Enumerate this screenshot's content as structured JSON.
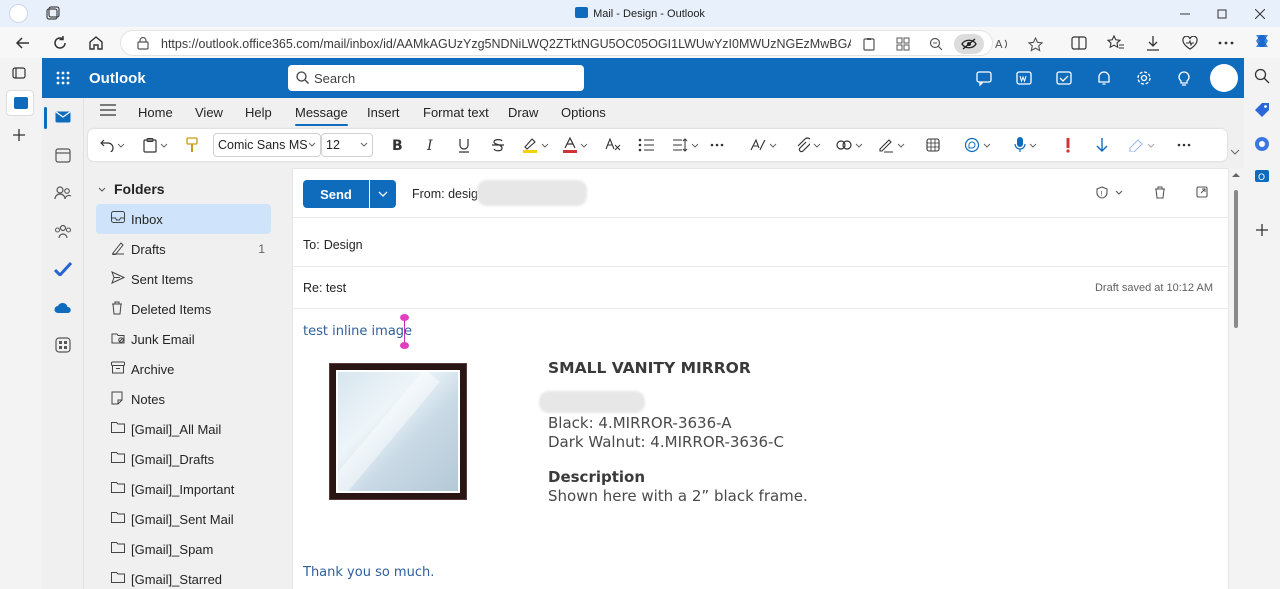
{
  "browser": {
    "window_title": "Mail - Design - Outlook",
    "url": "https://outlook.office365.com/mail/inbox/id/AAMkAGUzYzg5NDNiLWQ2ZTktNGU5OC05OGI1LWUwYzI0MWUzNGEzMwBGAAAAAA..."
  },
  "outlook": {
    "app_name": "Outlook",
    "search_placeholder": "Search",
    "ribbon_tabs": [
      "Home",
      "View",
      "Help",
      "Message",
      "Insert",
      "Format text",
      "Draw",
      "Options"
    ],
    "active_tab": "Message",
    "font_name": "Comic Sans MS",
    "font_size": "12"
  },
  "folders": {
    "header": "Folders",
    "items": [
      {
        "label": "Inbox",
        "count": "",
        "icon": "inbox-icon"
      },
      {
        "label": "Drafts",
        "count": "1",
        "icon": "drafts-icon"
      },
      {
        "label": "Sent Items",
        "count": "",
        "icon": "send-icon"
      },
      {
        "label": "Deleted Items",
        "count": "",
        "icon": "trash-icon"
      },
      {
        "label": "Junk Email",
        "count": "",
        "icon": "junk-icon"
      },
      {
        "label": "Archive",
        "count": "",
        "icon": "archive-icon"
      },
      {
        "label": "Notes",
        "count": "",
        "icon": "note-icon"
      },
      {
        "label": "[Gmail]_All Mail",
        "count": "",
        "icon": "folder-icon"
      },
      {
        "label": "[Gmail]_Drafts",
        "count": "",
        "icon": "folder-icon"
      },
      {
        "label": "[Gmail]_Important",
        "count": "",
        "icon": "folder-icon"
      },
      {
        "label": "[Gmail]_Sent Mail",
        "count": "",
        "icon": "folder-icon"
      },
      {
        "label": "[Gmail]_Spam",
        "count": "",
        "icon": "folder-icon"
      },
      {
        "label": "[Gmail]_Starred",
        "count": "",
        "icon": "folder-icon"
      }
    ]
  },
  "compose": {
    "send_label": "Send",
    "from_label": "From: design",
    "to_label": "To:",
    "to_value": "Design",
    "subject": "Re: test",
    "draft_status": "Draft saved at 10:12 AM",
    "body_first_line": "test inline image",
    "closing_line": "Thank you so much."
  },
  "product": {
    "title": "SMALL VANITY MIRROR",
    "line1": "Black: 4.MIRROR-3636-A",
    "line2": "Dark Walnut: 4.MIRROR-3636-C",
    "desc_heading": "Description",
    "desc_text": "Shown here with a 2” black frame."
  },
  "colors": {
    "accent": "#0f6cbd",
    "selected_folder": "#cfe4fa",
    "body_text": "#2d5f9a"
  }
}
